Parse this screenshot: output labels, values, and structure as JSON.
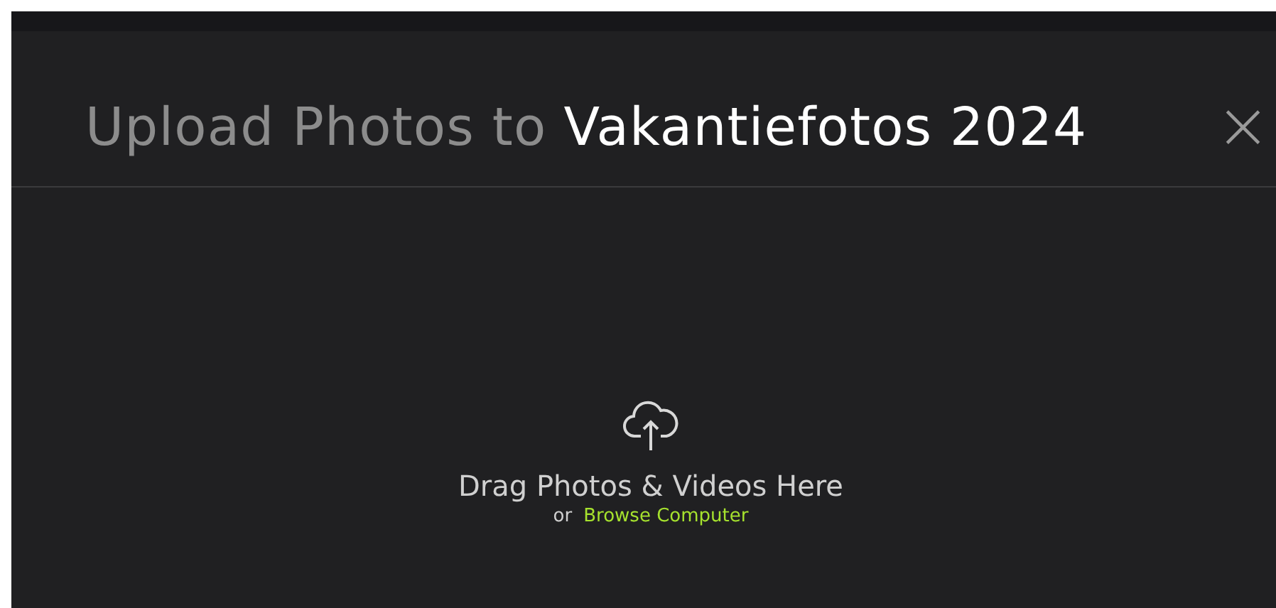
{
  "dialog": {
    "title_lead": "Upload Photos to",
    "album_name": "Vakantiefotos 2024",
    "close": "×"
  },
  "dropzone": {
    "prompt": "Drag Photos & Videos Here",
    "or": "or",
    "browse_link": "Browse Computer"
  }
}
